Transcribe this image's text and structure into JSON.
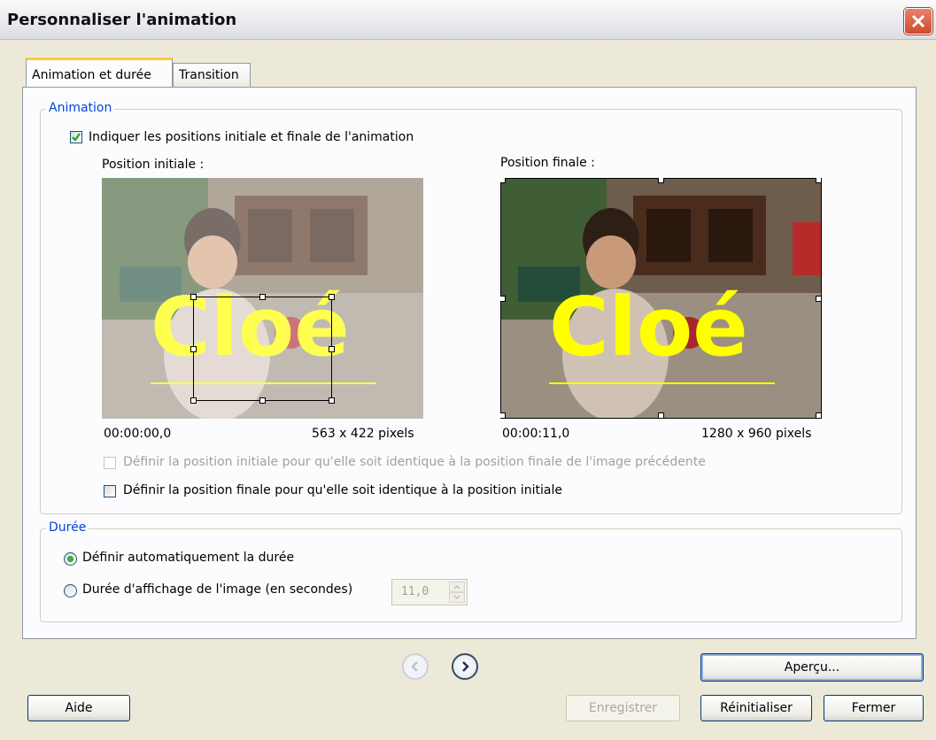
{
  "window": {
    "title": "Personnaliser l'animation"
  },
  "tabs": [
    {
      "label": "Animation et durée"
    },
    {
      "label": "Transition"
    }
  ],
  "animation": {
    "group_title": "Animation",
    "indicate_checkbox_label": "Indiquer les positions initiale et finale de l'animation",
    "indicate_checked": true,
    "start": {
      "label": "Position initiale :",
      "time": "00:00:00,0",
      "size": "563 x 422 pixels"
    },
    "end": {
      "label": "Position finale :",
      "time": "00:00:11,0",
      "size": "1280 x 960 pixels"
    },
    "photo_text": "Cloé",
    "same_as_previous_label": "Définir la position initiale pour qu'elle soit identique à la position finale de l'image précédente",
    "same_as_start_label": "Définir la position finale pour qu'elle soit identique à la position initiale"
  },
  "duration": {
    "group_title": "Durée",
    "auto_label": "Définir automatiquement la durée",
    "manual_label": "Durée d'affichage de l'image (en secondes)",
    "value": "11,0"
  },
  "buttons": {
    "preview": "Aperçu...",
    "help": "Aide",
    "save": "Enregistrer",
    "reset": "Réinitialiser",
    "close": "Fermer"
  },
  "colors": {
    "accent": "#0046d5",
    "title_text_on_photo": "#ffff00",
    "close_button": "#d04a2b"
  }
}
